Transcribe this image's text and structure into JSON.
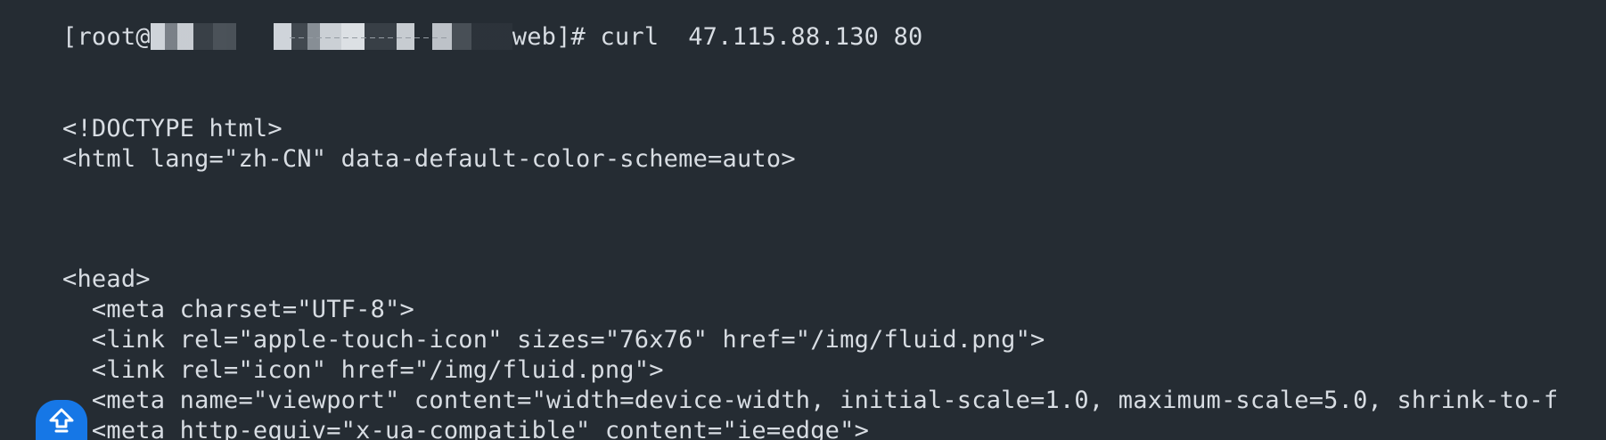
{
  "terminal": {
    "prompt_prefix": "[root@",
    "prompt_suffix": "web]# ",
    "command": "curl  47.115.88.130 80",
    "output_lines": [
      "<!DOCTYPE html>",
      "<html lang=\"zh-CN\" data-default-color-scheme=auto>",
      "<head>",
      "  <meta charset=\"UTF-8\">",
      "  <link rel=\"apple-touch-icon\" sizes=\"76x76\" href=\"/img/fluid.png\">",
      "  <link rel=\"icon\" href=\"/img/fluid.png\">",
      "  <meta name=\"viewport\" content=\"width=device-width, initial-scale=1.0, maximum-scale=5.0, shrink-to-f",
      "  <meta http-equiv=\"x-ua-compatible\" content=\"ie=edge\">"
    ]
  },
  "scroll_button": {
    "icon": "arrow-up-icon",
    "color": "#1677e6"
  }
}
